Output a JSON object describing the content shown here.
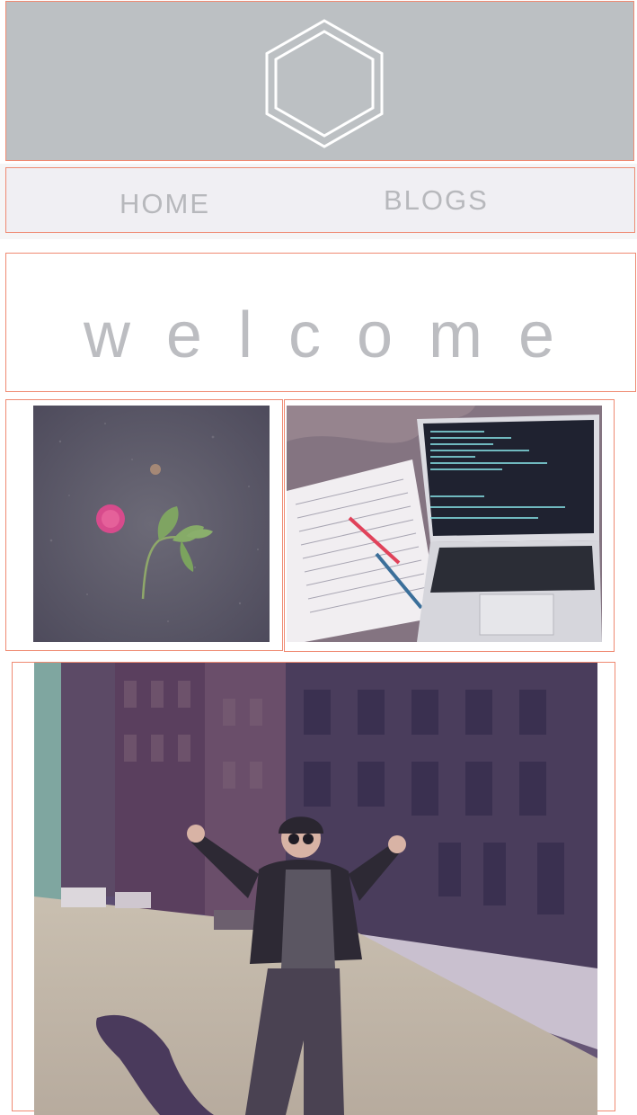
{
  "header": {
    "logo_icon": "hexagon-logo-icon",
    "background": "#bcc0c3",
    "logo_color": "#ffffff"
  },
  "nav": {
    "items": [
      {
        "label": "HOME"
      },
      {
        "label": "BLOGS"
      }
    ],
    "text_color": "#b7b8bc"
  },
  "welcome": {
    "text": "welcome",
    "color": "#bcbdc1"
  },
  "gallery": {
    "photos": [
      {
        "name": "flower-photo"
      },
      {
        "name": "laptop-notebook-photo"
      },
      {
        "name": "street-portrait-photo"
      }
    ]
  },
  "accent": {
    "outline": "#ef8a72"
  }
}
